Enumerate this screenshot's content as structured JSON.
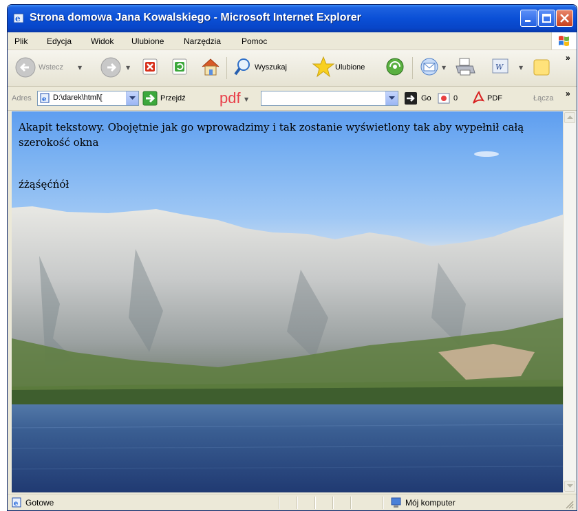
{
  "window": {
    "title": "Strona domowa Jana Kowalskiego - Microsoft Internet Explorer"
  },
  "menu": {
    "items": [
      "Plik",
      "Edycja",
      "Widok",
      "Ulubione",
      "Narzędzia",
      "Pomoc"
    ]
  },
  "toolbar": {
    "back_label": "Wstecz",
    "search_label": "Wyszukaj",
    "favorites_label": "Ulubione"
  },
  "address": {
    "label": "Adres",
    "value": "D:\\darek\\html\\[",
    "go_label": "Przejdź",
    "pdf_logo": "pdf",
    "search_value": "",
    "go2_label": "Go",
    "badge_count": "0",
    "pdf_label": "PDF",
    "links_label": "Łącza"
  },
  "content": {
    "paragraph": "Akapit tekstowy. Obojętnie jak go wprowadzimy i tak zostanie wyświetlony tak aby wypełnił całą szerokość okna",
    "special_chars": "źżąśęćńół"
  },
  "status": {
    "text": "Gotowe",
    "zone": "Mój komputer"
  },
  "colors": {
    "title_bar": "#0A4FD6",
    "chrome": "#ECE9D8",
    "sky": "#7BB2F2",
    "sea": "#2E4E82"
  }
}
